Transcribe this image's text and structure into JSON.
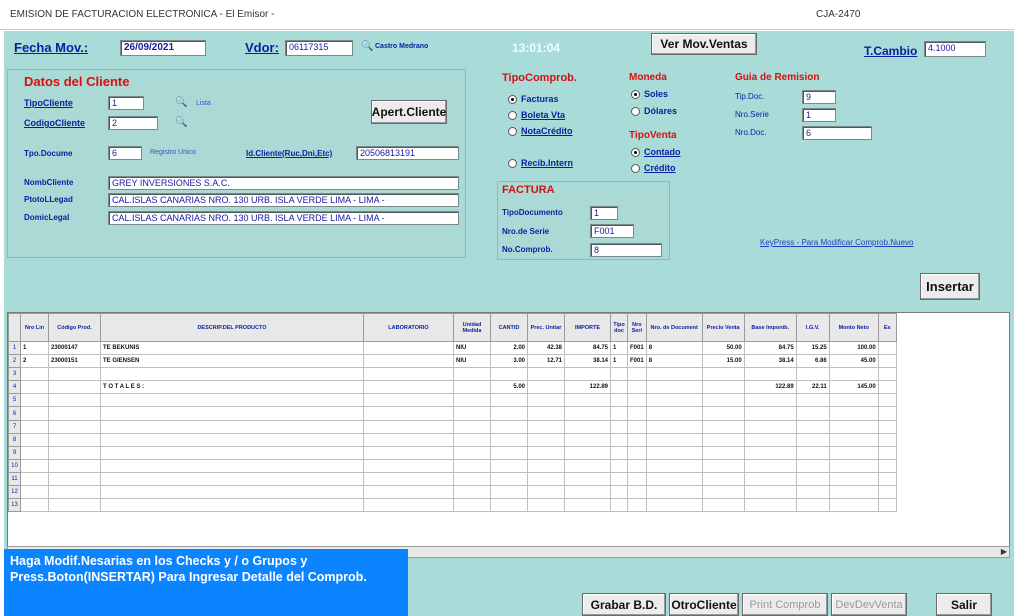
{
  "window": {
    "title": "EMISION DE FACTURACION ELECTRONICA  -  El Emisor  -",
    "code": "CJA-2470"
  },
  "header": {
    "fecha_label": "Fecha Mov.:",
    "fecha_value": "26/09/2021",
    "vdor_label": "Vdor:",
    "vdor_value": "06117315",
    "vdor_name": "Castro Medrano",
    "clock": "13:01:04",
    "ver_mov_button": "Ver Mov.Ventas",
    "tcambio_label": "T.Cambio",
    "tcambio_value": "4.1000"
  },
  "cliente": {
    "title": "Datos del Cliente",
    "tipo_label": "TipoCliente",
    "tipo_value": "1",
    "tipo_desc": "Lista",
    "codigo_label": "CodigoCliente",
    "codigo_value": "2",
    "apert_button": "Apert.Cliente",
    "tipo_doc_label": "Tpo.Docume",
    "tipo_doc_value": "6",
    "tipo_doc_desc": "Registro Unico",
    "nro_doc_label": "Id.Cliente(Ruc,Dni,Etc)",
    "nro_doc_value": "20506813191",
    "nombre_label": "NombCliente",
    "nombre_value": "GREY INVERSIONES S.A.C.",
    "ptolleg_label": "PtotoLLegad",
    "ptolleg_value": "CAL.ISLAS CANARIAS NRO. 130 URB. ISLA VERDE LIMA - LIMA -",
    "domic_label": "DomicLegal",
    "domic_value": "CAL.ISLAS CANARIAS NRO. 130 URB. ISLA VERDE LIMA - LIMA -"
  },
  "tipo_comprob": {
    "title": "TipoComprob.",
    "options": [
      "Facturas",
      "Boleta Vta",
      "NotaCrédito",
      "Recib.Intern"
    ],
    "selected": "Facturas"
  },
  "moneda": {
    "title": "Moneda",
    "options": [
      "Soles",
      "Dólares"
    ],
    "selected": "Soles"
  },
  "tipo_venta": {
    "title": "TipoVenta",
    "options": [
      "Contado",
      "Crédito"
    ],
    "selected": "Contado"
  },
  "guia": {
    "title": "Guia de Remision",
    "tip_doc_label": "Tip.Doc.",
    "tip_doc_value": "9",
    "nro_serie_label": "Nro.Serie",
    "nro_serie_value": "1",
    "nro_doc_label": "Nro.Doc.",
    "nro_doc_value": "6"
  },
  "factura": {
    "title": "FACTURA",
    "tipo_doc_label": "TipoDocumento",
    "tipo_doc_value": "1",
    "serie_label": "Nro.de Serie",
    "serie_value": "F001",
    "comprob_label": "No.Comprob.",
    "comprob_value": "8"
  },
  "keypress_hint": "KeyPress - Para Modificar Comprob.Nuevo",
  "insertar_button": "Insertar",
  "grid": {
    "columns": [
      "Nro Lin",
      "Código Prod.",
      "DESCRIP.DEL PRODUCTO",
      "LABORATORIO",
      "Unidad Medida",
      "CANTID",
      "Prec. Unitar",
      "IMPORTE",
      "Tipo doc",
      "Nro Seri",
      "Nro. de Document",
      "Precio Venta",
      "Base Imponib.",
      "I.G.V.",
      "Monto Neto",
      "Es"
    ],
    "rows": [
      {
        "n": "1",
        "cells": [
          "1",
          "23000147",
          "TE BEKUNIS",
          "",
          "NIU",
          "2.00",
          "42.38",
          "84.75",
          "1",
          "F001",
          "8",
          "50.00",
          "84.75",
          "15.25",
          "100.00",
          ""
        ]
      },
      {
        "n": "2",
        "cells": [
          "2",
          "23000151",
          "TE GIENSEN",
          "",
          "NIU",
          "3.00",
          "12.71",
          "38.14",
          "1",
          "F001",
          "8",
          "15.00",
          "38.14",
          "6.86",
          "45.00",
          ""
        ]
      },
      {
        "n": "3",
        "cells": [
          "",
          "",
          "",
          "",
          "",
          "",
          "",
          "",
          "",
          "",
          "",
          "",
          "",
          "",
          "",
          ""
        ]
      },
      {
        "n": "4",
        "cells": [
          "",
          "",
          "T O T A L E S :",
          "",
          "",
          "5.00",
          "",
          "122.89",
          "",
          "",
          "",
          "",
          "122.89",
          "22.11",
          "145.00",
          ""
        ]
      },
      {
        "n": "5",
        "cells": [
          "",
          "",
          "",
          "",
          "",
          "",
          "",
          "",
          "",
          "",
          "",
          "",
          "",
          "",
          "",
          ""
        ]
      },
      {
        "n": "6",
        "cells": [
          "",
          "",
          "",
          "",
          "",
          "",
          "",
          "",
          "",
          "",
          "",
          "",
          "",
          "",
          "",
          ""
        ]
      },
      {
        "n": "7",
        "cells": [
          "",
          "",
          "",
          "",
          "",
          "",
          "",
          "",
          "",
          "",
          "",
          "",
          "",
          "",
          "",
          ""
        ]
      },
      {
        "n": "8",
        "cells": [
          "",
          "",
          "",
          "",
          "",
          "",
          "",
          "",
          "",
          "",
          "",
          "",
          "",
          "",
          "",
          ""
        ]
      },
      {
        "n": "9",
        "cells": [
          "",
          "",
          "",
          "",
          "",
          "",
          "",
          "",
          "",
          "",
          "",
          "",
          "",
          "",
          "",
          ""
        ]
      },
      {
        "n": "10",
        "cells": [
          "",
          "",
          "",
          "",
          "",
          "",
          "",
          "",
          "",
          "",
          "",
          "",
          "",
          "",
          "",
          ""
        ]
      },
      {
        "n": "11",
        "cells": [
          "",
          "",
          "",
          "",
          "",
          "",
          "",
          "",
          "",
          "",
          "",
          "",
          "",
          "",
          "",
          ""
        ]
      },
      {
        "n": "12",
        "cells": [
          "",
          "",
          "",
          "",
          "",
          "",
          "",
          "",
          "",
          "",
          "",
          "",
          "",
          "",
          "",
          ""
        ]
      },
      {
        "n": "13",
        "cells": [
          "",
          "",
          "",
          "",
          "",
          "",
          "",
          "",
          "",
          "",
          "",
          "",
          "",
          "",
          "",
          ""
        ]
      }
    ]
  },
  "message": "Haga Modif.Nesarias en los Checks y / o Grupos y Press.Boton(INSERTAR) Para Ingresar Detalle del Comprob.",
  "footer": {
    "grabar": "Grabar B.D.",
    "otro_cliente": "OtroCliente",
    "print_comprob": "Print Comprob",
    "dev_vta": "DevDevVenta",
    "salir": "Salir"
  },
  "colors": {
    "form_bg": "#a9dcd8",
    "label_blue": "#0a1ea0",
    "label_red": "#d41010",
    "message_bg": "#0a84ff"
  }
}
